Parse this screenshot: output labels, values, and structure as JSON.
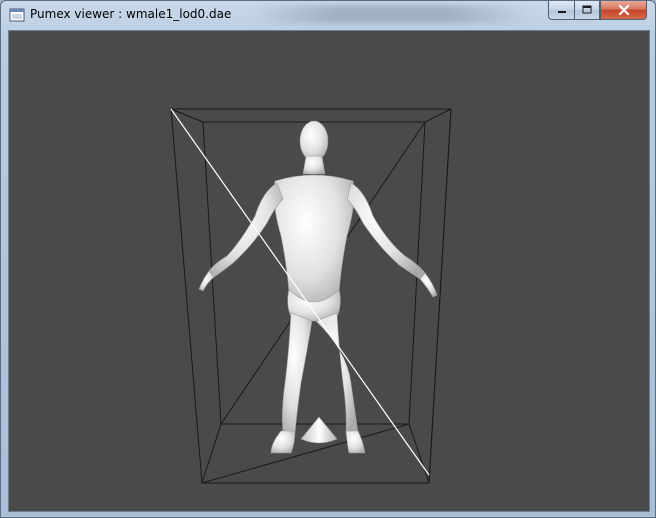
{
  "window": {
    "title": "Pumex viewer : wmale1_lod0.dae",
    "buttons": {
      "minimize_icon": "minimize-icon",
      "maximize_icon": "maximize-icon",
      "close_icon": "close-icon"
    }
  },
  "viewport": {
    "background": "#4a4a4a",
    "model_color": "#e6e6e6",
    "frustum_color": "#111111",
    "diagonal_color": "#ffffff"
  }
}
